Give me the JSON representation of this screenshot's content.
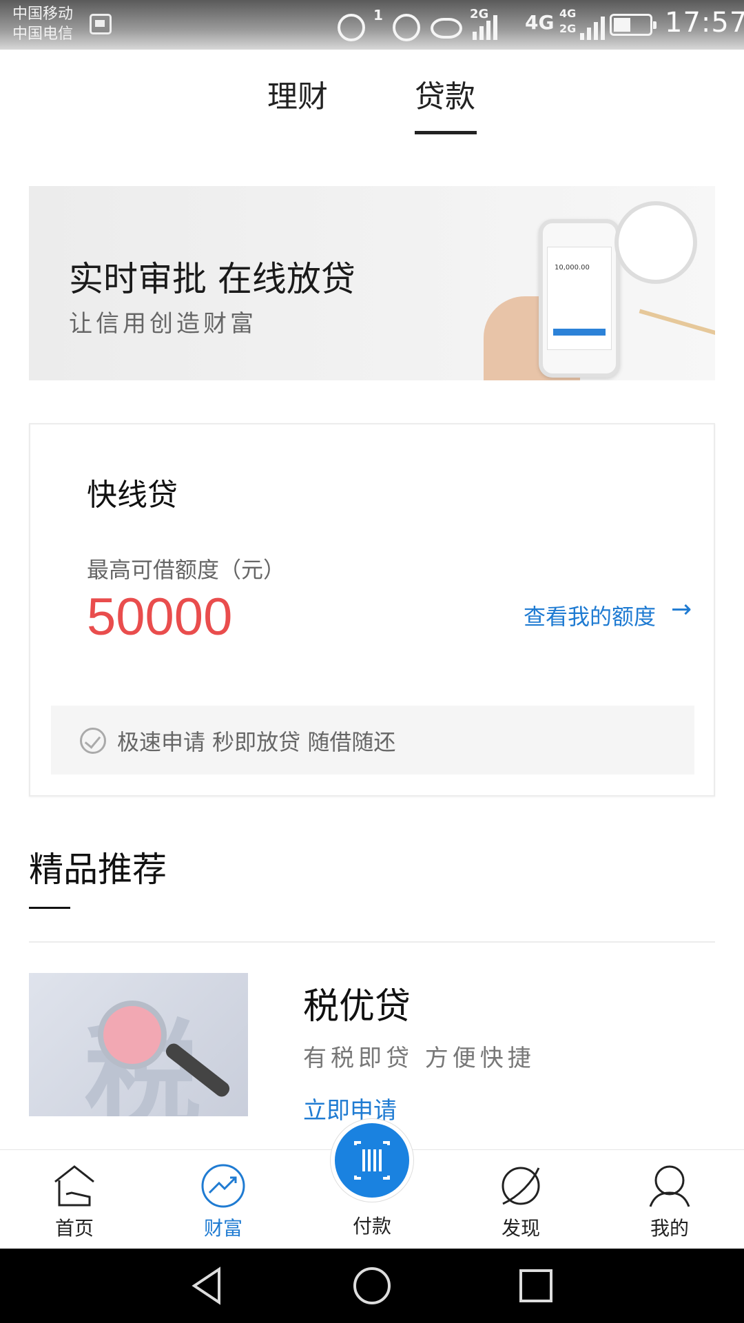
{
  "status_bar": {
    "carrier_1": "中国移动",
    "carrier_2": "中国电信",
    "notification_count": "1",
    "network_a": "2G",
    "network_b": "4G",
    "network_c_top": "4G",
    "network_c_bottom": "2G",
    "time": "17:57"
  },
  "tabs": [
    {
      "label": "理财",
      "active": false
    },
    {
      "label": "贷款",
      "active": true
    }
  ],
  "banner": {
    "title": "实时审批 在线放贷",
    "subtitle": "让信用创造财富",
    "phone_screen_amount": "10,000.00"
  },
  "loan_card": {
    "title": "快线贷",
    "amount_label": "最高可借额度（元）",
    "amount": "50000",
    "link_label": "查看我的额度",
    "feature": "极速申请 秒即放贷 随借随还"
  },
  "recommend": {
    "section_title": "精品推荐",
    "product": {
      "image_char": "税",
      "title": "税优贷",
      "subtitle": "有税即贷 方便快捷",
      "apply_label": "立即申请"
    }
  },
  "bottom_nav": {
    "items": [
      {
        "label": "首页",
        "icon": "home-icon"
      },
      {
        "label": "财富",
        "icon": "wealth-icon",
        "active": true
      },
      {
        "label": "付款",
        "icon": "barcode-icon"
      },
      {
        "label": "发现",
        "icon": "planet-icon"
      },
      {
        "label": "我的",
        "icon": "user-icon"
      }
    ]
  },
  "colors": {
    "accent": "#1f7bd2",
    "amount_red": "#e94d4d",
    "pay_button": "#1a82e0"
  }
}
